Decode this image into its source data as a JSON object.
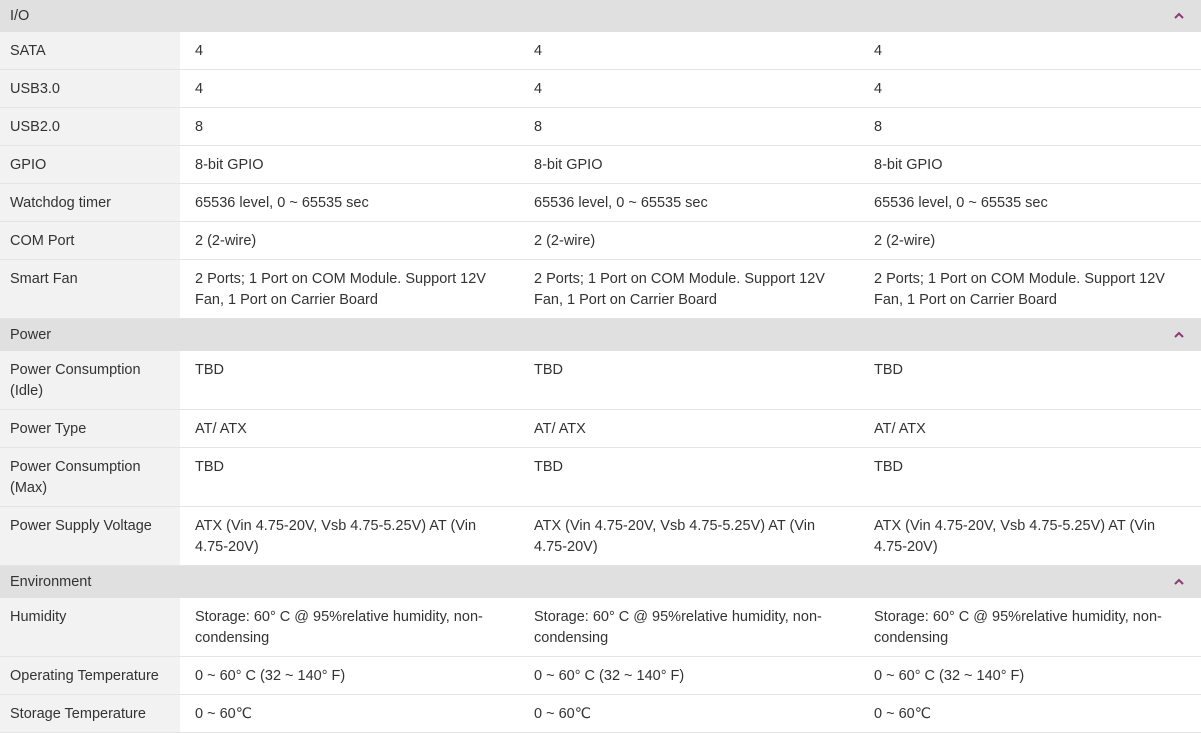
{
  "sections": [
    {
      "title": "I/O",
      "rows": [
        {
          "label": "SATA",
          "values": [
            "4",
            "4",
            "4"
          ]
        },
        {
          "label": "USB3.0",
          "values": [
            "4",
            "4",
            "4"
          ]
        },
        {
          "label": "USB2.0",
          "values": [
            "8",
            "8",
            "8"
          ]
        },
        {
          "label": "GPIO",
          "values": [
            "8-bit GPIO",
            "8-bit GPIO",
            "8-bit GPIO"
          ]
        },
        {
          "label": "Watchdog timer",
          "values": [
            "65536 level, 0 ~ 65535 sec",
            "65536 level, 0 ~ 65535 sec",
            "65536 level, 0 ~ 65535 sec"
          ]
        },
        {
          "label": "COM Port",
          "values": [
            "2 (2-wire)",
            "2 (2-wire)",
            "2 (2-wire)"
          ]
        },
        {
          "label": "Smart Fan",
          "values": [
            "2 Ports; 1 Port on COM Module. Support 12V Fan, 1 Port on Carrier Board",
            "2 Ports; 1 Port on COM Module. Support 12V Fan, 1 Port on Carrier Board",
            "2 Ports; 1 Port on COM Module. Support 12V Fan, 1 Port on Carrier Board"
          ]
        }
      ]
    },
    {
      "title": "Power",
      "rows": [
        {
          "label": "Power Consumption (Idle)",
          "values": [
            "TBD",
            "TBD",
            "TBD"
          ]
        },
        {
          "label": "Power Type",
          "values": [
            "AT/ ATX",
            "AT/ ATX",
            "AT/ ATX"
          ]
        },
        {
          "label": "Power Consumption (Max)",
          "values": [
            "TBD",
            "TBD",
            "TBD"
          ]
        },
        {
          "label": "Power Supply Voltage",
          "values": [
            "ATX (Vin 4.75-20V, Vsb 4.75-5.25V) AT (Vin 4.75-20V)",
            "ATX (Vin 4.75-20V, Vsb 4.75-5.25V) AT (Vin 4.75-20V)",
            "ATX (Vin 4.75-20V, Vsb 4.75-5.25V) AT (Vin 4.75-20V)"
          ]
        }
      ]
    },
    {
      "title": "Environment",
      "rows": [
        {
          "label": "Humidity",
          "values": [
            "Storage: 60° C @ 95%relative humidity, non-condensing",
            "Storage: 60° C @ 95%relative humidity, non-condensing",
            "Storage: 60° C @ 95%relative humidity, non-condensing"
          ]
        },
        {
          "label": "Operating Temperature",
          "values": [
            "0 ~ 60° C (32 ~ 140° F)",
            "0 ~ 60° C (32 ~ 140° F)",
            "0 ~ 60° C (32 ~ 140° F)"
          ]
        },
        {
          "label": "Storage Temperature",
          "values": [
            "0 ~ 60℃",
            "0 ~ 60℃",
            "0 ~ 60℃"
          ]
        }
      ]
    }
  ],
  "icons": {
    "collapse": "chevron-up-icon"
  },
  "colors": {
    "section_header_bg": "#e0e0e0",
    "label_bg": "#f2f2f2",
    "text": "#333333",
    "chevron": "#8a3a78"
  }
}
